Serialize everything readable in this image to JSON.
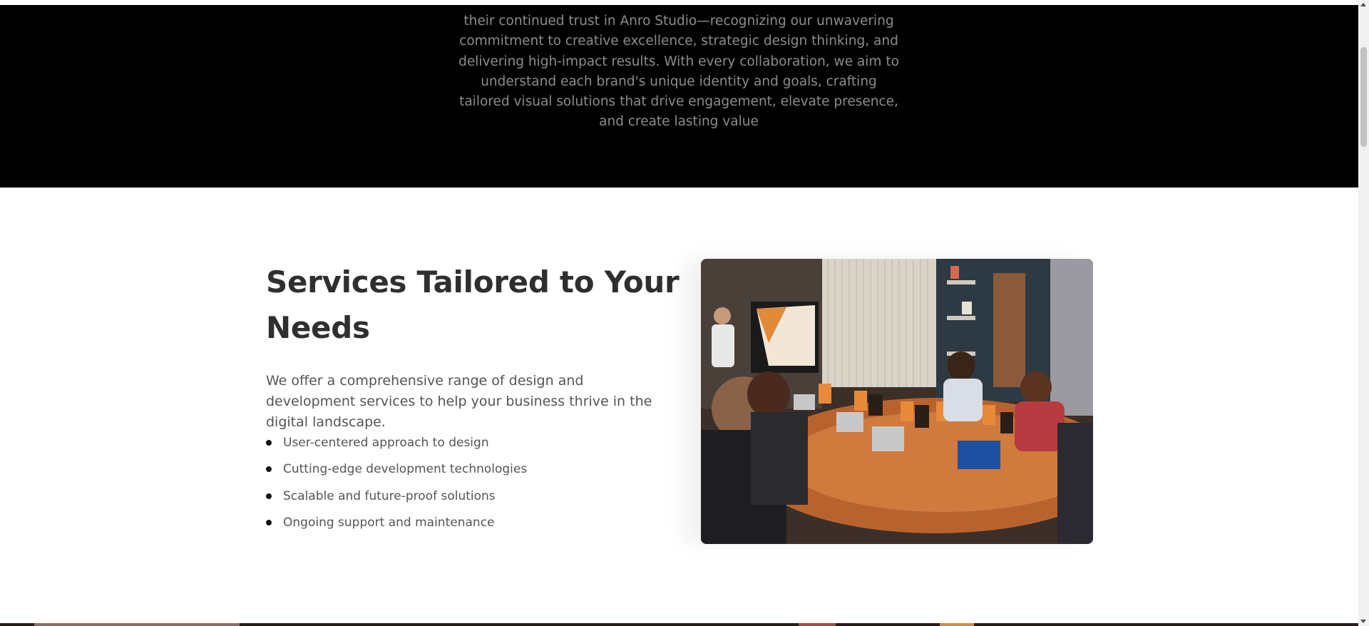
{
  "intro": {
    "text": "their continued trust in Anro Studio—recognizing our unwavering commitment to creative excellence, strategic design thinking, and delivering high-impact results. With every collaboration, we aim to understand each brand's unique identity and goals, crafting tailored visual solutions that drive engagement, elevate presence, and create lasting value"
  },
  "services": {
    "title": "Services Tailored to Your Needs",
    "description": "We offer a comprehensive range of design and development services to help your business thrive in the digital landscape.",
    "features": [
      "User-centered approach to design",
      "Cutting-edge development technologies",
      "Scalable and future-proof solutions",
      "Ongoing support and maintenance"
    ]
  },
  "colors": {
    "dark_section": "#000000",
    "intro_text": "#8c8c8c",
    "heading": "#2f2f2f",
    "body_text": "#555555"
  },
  "icons": {
    "bullet": "bullet-dot-icon",
    "scroll_up": "scroll-up-arrow-icon",
    "scroll_down": "scroll-down-arrow-icon"
  }
}
